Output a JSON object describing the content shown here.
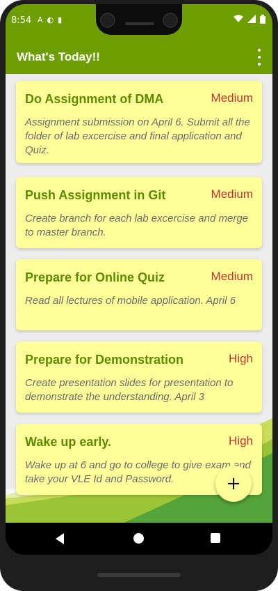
{
  "status_bar": {
    "time": "8:54",
    "left_icons": [
      "A",
      "◐",
      "▮"
    ],
    "right_icons": [
      "wifi-icon",
      "signal-icon",
      "battery-icon"
    ]
  },
  "app_bar": {
    "title": "What's Today!!"
  },
  "tasks": [
    {
      "title": "Do Assignment of DMA",
      "priority": "Medium",
      "description": "Assignment submission on April 6. Submit all the folder of lab excercise and final application and Quiz."
    },
    {
      "title": "Push Assignment in Git",
      "priority": "Medium",
      "description": "Create branch for each lab excercise and merge to master branch."
    },
    {
      "title": "Prepare for Online Quiz",
      "priority": "Medium",
      "description": "Read all lectures of mobile application. April 6"
    },
    {
      "title": "Prepare for Demonstration",
      "priority": "High",
      "description": "Create presentation slides for presentation to demonstrate the understanding. April 3"
    },
    {
      "title": "Wake up early.",
      "priority": "High",
      "description": "Wake up at 6 and go to college to give exam and take your VLE Id and Password."
    }
  ],
  "fab": {
    "label": "+"
  },
  "colors": {
    "primary": "#6e9d00",
    "card": "#ffff99",
    "title": "#5d8b00",
    "priority": "#c2342c"
  }
}
